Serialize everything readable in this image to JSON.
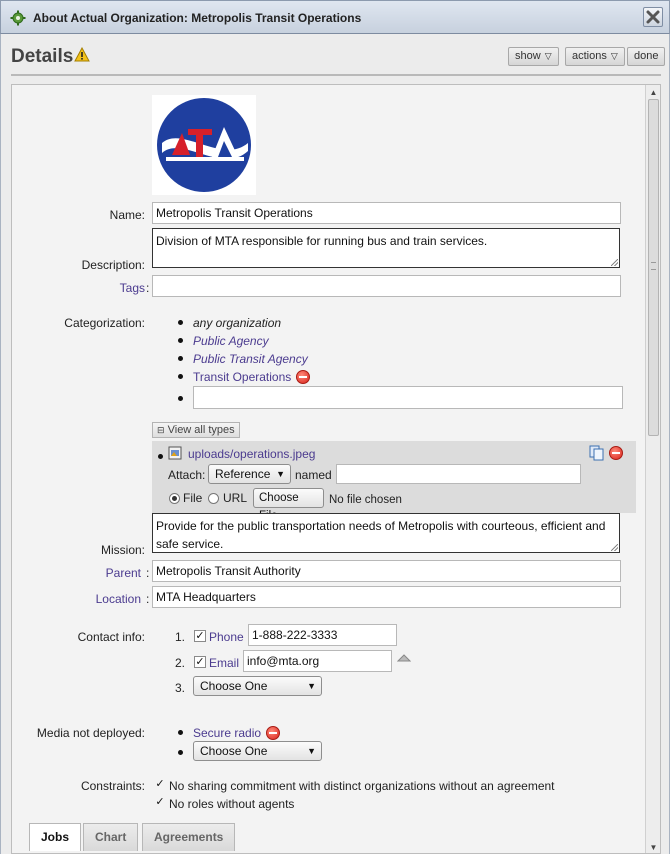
{
  "window": {
    "title": "About Actual Organization: Metropolis Transit Operations"
  },
  "header": {
    "title": "Details",
    "show_label": "show",
    "actions_label": "actions",
    "done_label": "done"
  },
  "form": {
    "name_label": "Name:",
    "name_value": "Metropolis Transit Operations",
    "description_label": "Description:",
    "description_value": "Division of MTA responsible for running bus and train services.",
    "tags_label": "Tags",
    "tags_value": "",
    "categorization_label": "Categorization:",
    "categories": [
      "any organization",
      "Public Agency",
      "Public Transit Agency",
      "Transit Operations"
    ],
    "view_all_types_label": "View all types",
    "attachment": {
      "file_link": "uploads/operations.jpeg",
      "attach_label": "Attach:",
      "attach_type": "Reference",
      "named_label": "named",
      "named_value": "",
      "file_option": "File",
      "url_option": "URL",
      "choose_file_label": "Choose File",
      "no_file_text": "No file chosen"
    },
    "mission_label": "Mission:",
    "mission_value": "Provide for the public transportation needs of Metropolis with courteous, efficient and safe service.",
    "parent_label": "Parent",
    "parent_value": "Metropolis Transit Authority",
    "location_label": "Location",
    "location_value": "MTA Headquarters",
    "contact_label": "Contact info:",
    "contacts": [
      {
        "num": "1.",
        "type": "Phone",
        "value": "1-888-222-3333"
      },
      {
        "num": "2.",
        "type": "Email",
        "value": "info@mta.org"
      },
      {
        "num": "3.",
        "choose": "Choose One"
      }
    ],
    "media_label": "Media not deployed:",
    "media_items": [
      "Secure radio"
    ],
    "media_choose": "Choose One",
    "constraints_label": "Constraints:",
    "constraints": [
      "No sharing commitment with distinct organizations without an agreement",
      "No roles without agents"
    ]
  },
  "tabs": [
    "Jobs",
    "Chart",
    "Agreements"
  ],
  "colors": {
    "link": "#4b3b8f",
    "remove_red": "#d8221a",
    "logo_blue": "#1f3f9f",
    "logo_red": "#d6202a"
  }
}
